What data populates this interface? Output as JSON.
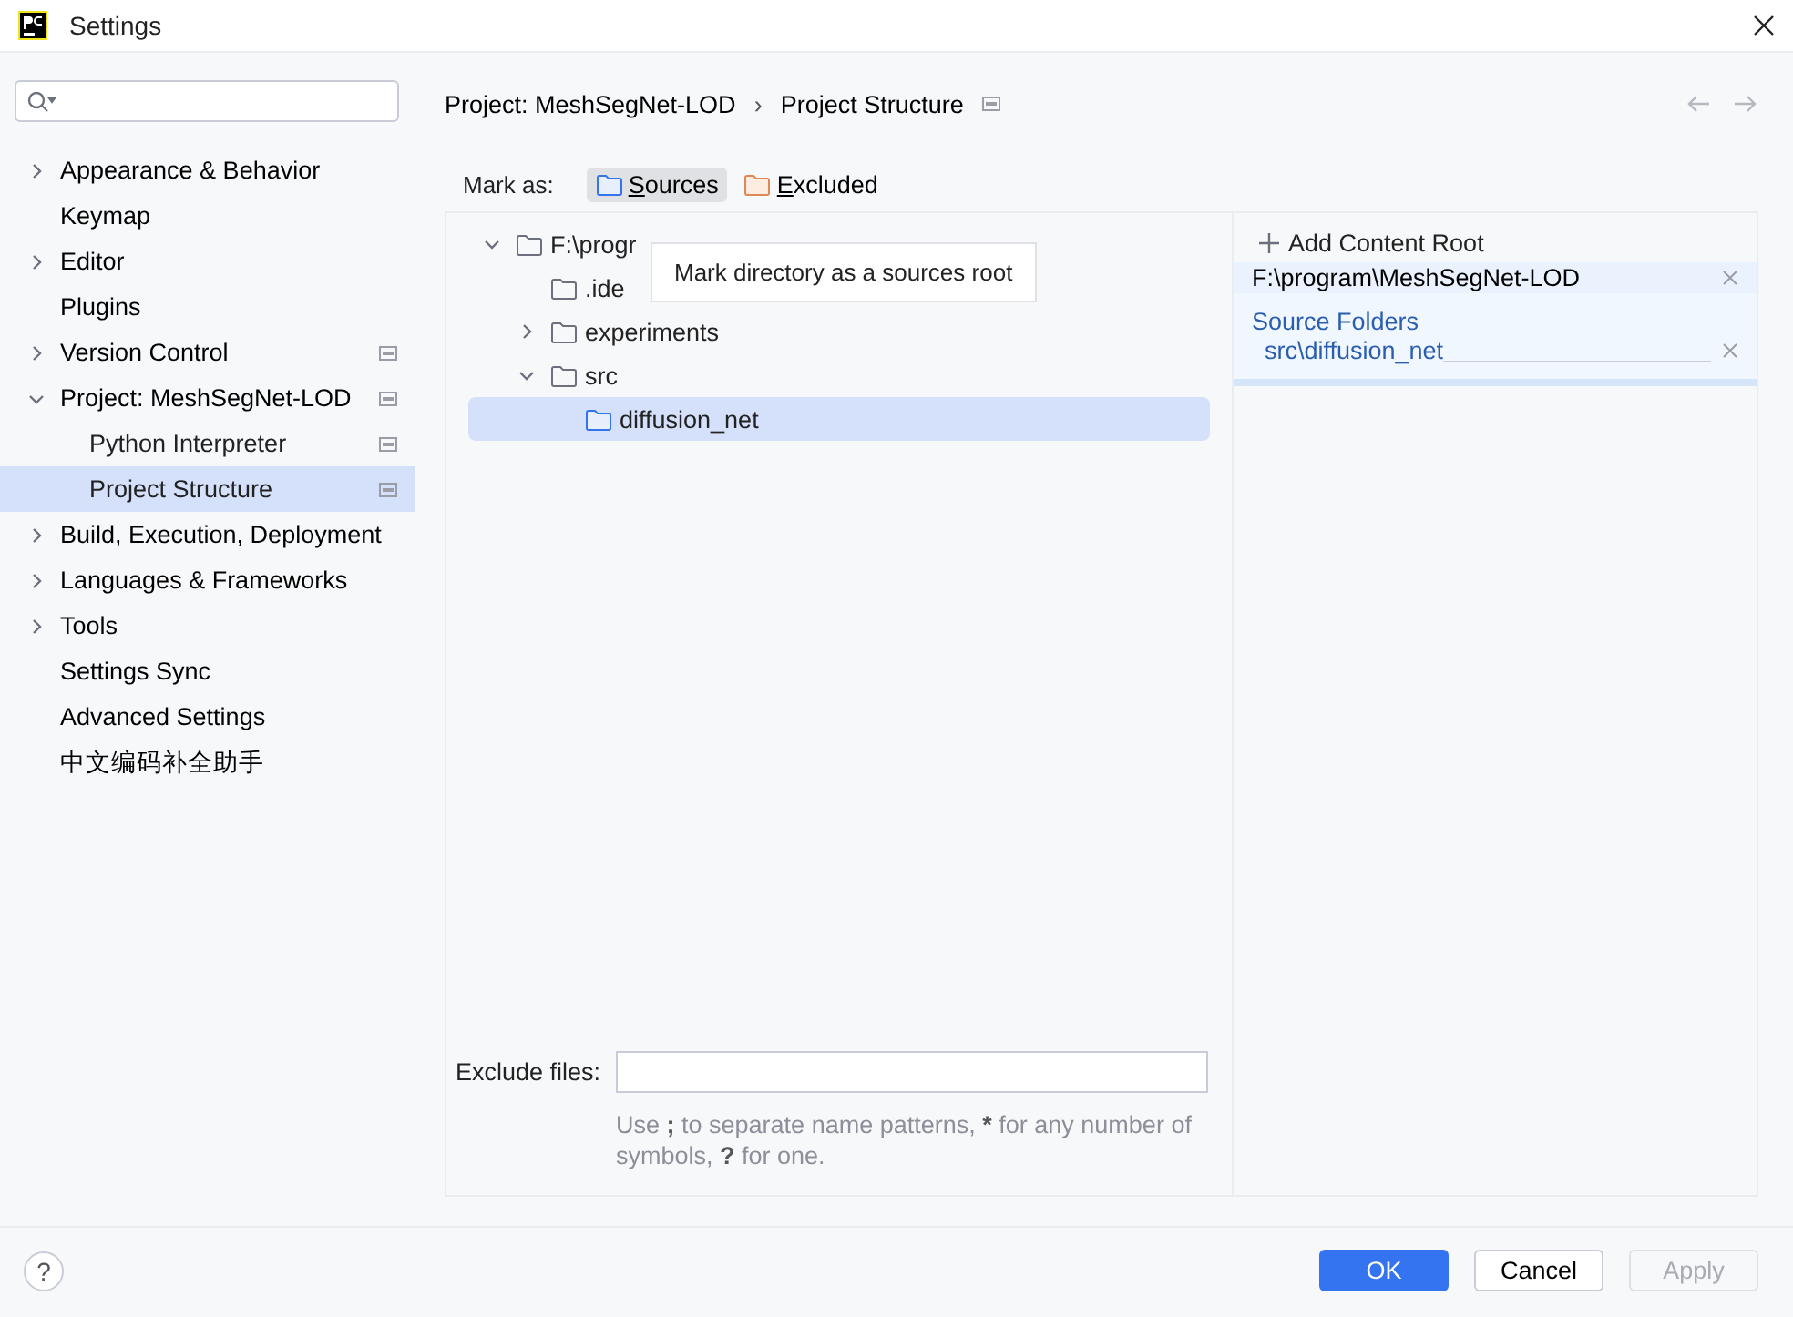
{
  "window": {
    "title": "Settings"
  },
  "sidebar": {
    "items": [
      {
        "label": "Appearance & Behavior",
        "expanded": false,
        "selected": false,
        "project_icon": false
      },
      {
        "label": "Keymap",
        "selected": false,
        "project_icon": false
      },
      {
        "label": "Editor",
        "expanded": false,
        "selected": false,
        "project_icon": false
      },
      {
        "label": "Plugins",
        "selected": false,
        "project_icon": false
      },
      {
        "label": "Version Control",
        "expanded": false,
        "selected": false,
        "project_icon": true
      },
      {
        "label": "Project: MeshSegNet-LOD",
        "expanded": true,
        "selected": false,
        "project_icon": true,
        "children": [
          {
            "label": "Python Interpreter",
            "selected": false,
            "project_icon": true
          },
          {
            "label": "Project Structure",
            "selected": true,
            "project_icon": true
          }
        ]
      },
      {
        "label": "Build, Execution, Deployment",
        "expanded": false,
        "selected": false,
        "project_icon": false
      },
      {
        "label": "Languages & Frameworks",
        "expanded": false,
        "selected": false,
        "project_icon": false
      },
      {
        "label": "Tools",
        "expanded": false,
        "selected": false,
        "project_icon": false
      },
      {
        "label": "Settings Sync",
        "selected": false,
        "project_icon": false
      },
      {
        "label": "Advanced Settings",
        "selected": false,
        "project_icon": false
      },
      {
        "label": "中文编码补全助手",
        "selected": false,
        "project_icon": false
      }
    ]
  },
  "breadcrumb": {
    "parent": "Project: MeshSegNet-LOD",
    "separator": "›",
    "current": "Project Structure"
  },
  "mark_as": {
    "label": "Mark as:",
    "buttons": [
      {
        "label": "Sources",
        "kind": "sources",
        "selected": true
      },
      {
        "label": "Excluded",
        "kind": "excluded",
        "selected": false
      }
    ]
  },
  "tree": {
    "nodes": [
      {
        "label": "F:\\progr",
        "expanded": true,
        "selected": false,
        "kind": "plain",
        "children": [
          {
            "label": ".ide",
            "selected": false,
            "kind": "plain"
          },
          {
            "label": "experiments",
            "expanded": false,
            "selected": false,
            "kind": "plain"
          },
          {
            "label": "src",
            "expanded": true,
            "selected": false,
            "kind": "plain",
            "children": [
              {
                "label": "diffusion_net",
                "selected": true,
                "kind": "source"
              }
            ]
          }
        ]
      }
    ]
  },
  "tooltip": {
    "text": "Mark directory as a sources root"
  },
  "content_root": {
    "add_label": "Add Content Root",
    "root": "F:\\program\\MeshSegNet-LOD",
    "section_title": "Source Folders",
    "folders": [
      "src\\diffusion_net"
    ]
  },
  "exclude": {
    "label": "Exclude files:",
    "hint": "Use **;** to separate name patterns, ***** for any number of symbols, **?** for one."
  },
  "footer": {
    "help": "?",
    "buttons": [
      {
        "label": "OK",
        "kind": "primary",
        "disabled": false
      },
      {
        "label": "Cancel",
        "kind": "secondary",
        "disabled": false
      },
      {
        "label": "Apply",
        "kind": "secondary",
        "disabled": true
      }
    ]
  }
}
